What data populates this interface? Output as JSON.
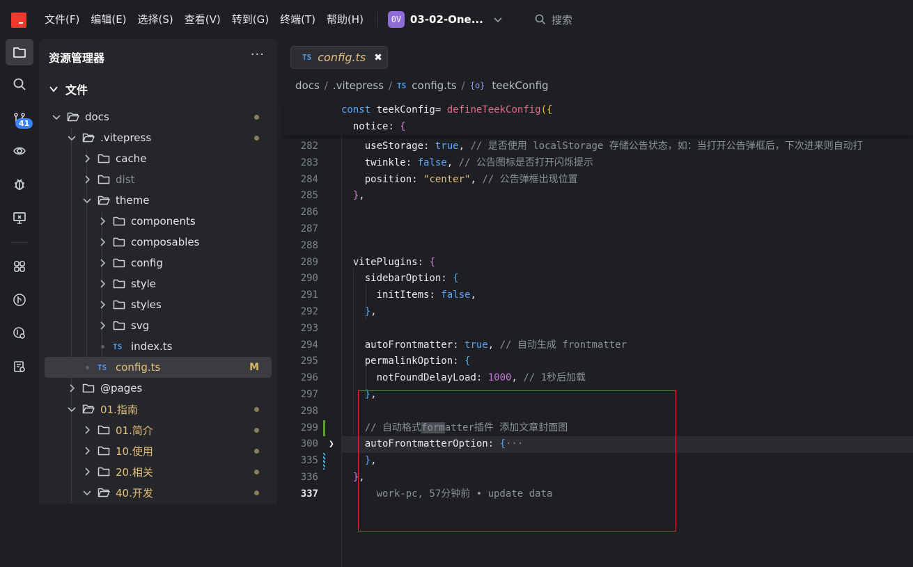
{
  "titlebar": {
    "menus": [
      "文件(F)",
      "编辑(E)",
      "选择(S)",
      "查看(V)",
      "转到(G)",
      "终端(T)",
      "帮助(H)"
    ],
    "project_badge": "0V",
    "project_name": "03-02-One...",
    "search_label": "搜索"
  },
  "activity": {
    "items": [
      "explorer-icon",
      "search-icon",
      "source-control-icon",
      "remote-icon",
      "debug-icon",
      "remote-explorer-icon",
      "extensions-icon",
      "git-graph-icon",
      "git-history-icon",
      "extension-settings-icon"
    ],
    "badge": "41"
  },
  "explorer": {
    "title": "资源管理器",
    "more": "···",
    "section": "文件",
    "tree": [
      {
        "label": "docs",
        "type": "folder",
        "expanded": true,
        "depth": 0,
        "dot": true
      },
      {
        "label": ".vitepress",
        "type": "folder",
        "expanded": true,
        "depth": 1,
        "dot": true
      },
      {
        "label": "cache",
        "type": "folder",
        "expanded": false,
        "depth": 2
      },
      {
        "label": "dist",
        "type": "folder",
        "expanded": false,
        "depth": 2,
        "dim": true
      },
      {
        "label": "theme",
        "type": "folder",
        "expanded": true,
        "depth": 2
      },
      {
        "label": "components",
        "type": "folder",
        "expanded": false,
        "depth": 3
      },
      {
        "label": "composables",
        "type": "folder",
        "expanded": false,
        "depth": 3
      },
      {
        "label": "config",
        "type": "folder",
        "expanded": false,
        "depth": 3
      },
      {
        "label": "style",
        "type": "folder",
        "expanded": false,
        "depth": 3
      },
      {
        "label": "styles",
        "type": "folder",
        "expanded": false,
        "depth": 3
      },
      {
        "label": "svg",
        "type": "folder",
        "expanded": false,
        "depth": 3
      },
      {
        "label": "index.ts",
        "type": "ts",
        "depth": 3
      },
      {
        "label": "config.ts",
        "type": "ts",
        "depth": 2,
        "selected": true,
        "status": "M"
      },
      {
        "label": "@pages",
        "type": "folder",
        "expanded": false,
        "depth": 1
      },
      {
        "label": "01.指南",
        "type": "folder",
        "expanded": true,
        "depth": 1,
        "dot": true,
        "gold": true
      },
      {
        "label": "01.简介",
        "type": "folder",
        "expanded": false,
        "depth": 2,
        "dot": true,
        "gold": true
      },
      {
        "label": "10.使用",
        "type": "folder",
        "expanded": false,
        "depth": 2,
        "dot": true,
        "gold": true
      },
      {
        "label": "20.相关",
        "type": "folder",
        "expanded": false,
        "depth": 2,
        "dot": true,
        "gold": true
      },
      {
        "label": "40.开发",
        "type": "folder",
        "expanded": true,
        "depth": 2,
        "dot": true,
        "gold": true
      }
    ]
  },
  "editor": {
    "tab": {
      "icon": "TS",
      "name": "config.ts",
      "close": "✖"
    },
    "breadcrumb": [
      "docs",
      ".vitepress",
      "config.ts",
      "teekConfig"
    ],
    "breadcrumb_ts": "TS",
    "breadcrumb_sym": "{o}",
    "sticky": [
      {
        "ln": "",
        "tokens": [
          [
            "k",
            "const "
          ],
          [
            "prop",
            "teekConfig"
          ],
          [
            "",
            "= "
          ],
          [
            "fn",
            "defineTeekConfig"
          ],
          [
            "br1",
            "({"
          ]
        ]
      },
      {
        "ln": "",
        "tokens": [
          [
            "",
            "  "
          ],
          [
            "prop",
            "notice"
          ],
          [
            "",
            ": "
          ],
          [
            "br2",
            "{"
          ]
        ]
      }
    ],
    "lines": [
      {
        "ln": "282",
        "tokens": [
          [
            "",
            "    "
          ],
          [
            "prop",
            "useStorage"
          ],
          [
            "",
            ": "
          ],
          [
            "bool",
            "true"
          ],
          [
            "",
            ", "
          ],
          [
            "cm",
            "// 是否使用 localStorage 存储公告状态，如：当打开公告弹框后，下次进来则自动打"
          ]
        ]
      },
      {
        "ln": "283",
        "tokens": [
          [
            "",
            "    "
          ],
          [
            "prop",
            "twinkle"
          ],
          [
            "",
            ": "
          ],
          [
            "bool",
            "false"
          ],
          [
            "",
            ", "
          ],
          [
            "cm",
            "// 公告图标是否打开闪烁提示"
          ]
        ]
      },
      {
        "ln": "284",
        "tokens": [
          [
            "",
            "    "
          ],
          [
            "prop",
            "position"
          ],
          [
            "",
            ": "
          ],
          [
            "str",
            "\"center\""
          ],
          [
            "",
            ", "
          ],
          [
            "cm",
            "// 公告弹框出现位置"
          ]
        ]
      },
      {
        "ln": "285",
        "tokens": [
          [
            "",
            "  "
          ],
          [
            "br2",
            "}"
          ],
          [
            "",
            ","
          ]
        ]
      },
      {
        "ln": "286",
        "tokens": []
      },
      {
        "ln": "287",
        "tokens": []
      },
      {
        "ln": "288",
        "tokens": []
      },
      {
        "ln": "289",
        "tokens": [
          [
            "",
            "  "
          ],
          [
            "prop",
            "vitePlugins"
          ],
          [
            "",
            ": "
          ],
          [
            "br2",
            "{"
          ]
        ]
      },
      {
        "ln": "290",
        "tokens": [
          [
            "",
            "    "
          ],
          [
            "prop",
            "sidebarOption"
          ],
          [
            "",
            ": "
          ],
          [
            "br3",
            "{"
          ]
        ]
      },
      {
        "ln": "291",
        "tokens": [
          [
            "",
            "      "
          ],
          [
            "prop",
            "initItems"
          ],
          [
            "",
            ": "
          ],
          [
            "bool",
            "false"
          ],
          [
            "",
            ","
          ]
        ]
      },
      {
        "ln": "292",
        "tokens": [
          [
            "",
            "    "
          ],
          [
            "br3",
            "}"
          ],
          [
            "",
            ","
          ]
        ]
      },
      {
        "ln": "293",
        "tokens": []
      },
      {
        "ln": "294",
        "tokens": [
          [
            "",
            "    "
          ],
          [
            "prop",
            "autoFrontmatter"
          ],
          [
            "",
            ": "
          ],
          [
            "bool",
            "true"
          ],
          [
            "",
            ", "
          ],
          [
            "cm",
            "// 自动生成 frontmatter"
          ]
        ]
      },
      {
        "ln": "295",
        "tokens": [
          [
            "",
            "    "
          ],
          [
            "prop",
            "permalinkOption"
          ],
          [
            "",
            ": "
          ],
          [
            "br3",
            "{"
          ]
        ]
      },
      {
        "ln": "296",
        "tokens": [
          [
            "",
            "      "
          ],
          [
            "prop",
            "notFoundDelayLoad"
          ],
          [
            "",
            ": "
          ],
          [
            "num",
            "1000"
          ],
          [
            "",
            ", "
          ],
          [
            "cm",
            "// 1秒后加载"
          ]
        ]
      },
      {
        "ln": "297",
        "tokens": [
          [
            "",
            "    "
          ],
          [
            "br3",
            "}"
          ],
          [
            "",
            ","
          ]
        ]
      },
      {
        "ln": "298",
        "tokens": []
      },
      {
        "ln": "299",
        "tokens": [
          [
            "",
            "    "
          ],
          [
            "cm",
            "// 自动格式"
          ],
          [
            "cmhl",
            "form"
          ],
          [
            "cm",
            "atter插件 添加文章封面图"
          ]
        ]
      },
      {
        "ln": "300",
        "tokens": [
          [
            "",
            "    "
          ],
          [
            "prop",
            "autoFrontmatterOption"
          ],
          [
            "",
            ": "
          ],
          [
            "br3",
            "{"
          ],
          [
            "cm",
            "···"
          ]
        ],
        "fold": true
      },
      {
        "ln": "335",
        "tokens": [
          [
            "",
            "    "
          ],
          [
            "br3",
            "}"
          ],
          [
            "",
            ","
          ]
        ]
      },
      {
        "ln": "336",
        "tokens": [
          [
            "",
            "  "
          ],
          [
            "br2",
            "}"
          ],
          [
            "",
            ","
          ]
        ]
      },
      {
        "ln": "337",
        "tokens": [
          [
            "",
            "      "
          ],
          [
            "cm",
            "work-pc, 57分钟前 • update data"
          ]
        ],
        "current": true
      }
    ]
  },
  "colors": {
    "accent": "#3b82f6",
    "highlight_box": "#d7302a",
    "git_added": "#5c9e31",
    "modified": "#d8b86a"
  }
}
